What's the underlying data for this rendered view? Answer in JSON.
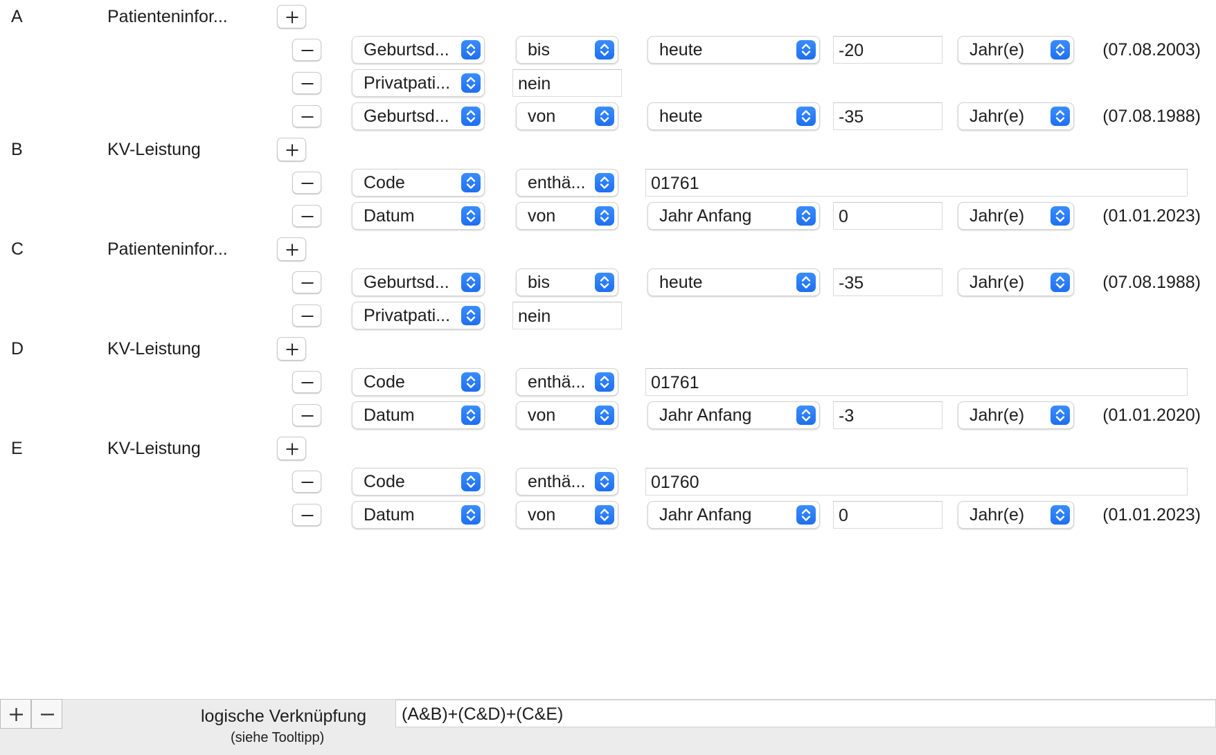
{
  "groups": [
    {
      "letter": "A",
      "name": "Patienteninfor...",
      "rows": [
        {
          "field": "Geburtsd...",
          "op": "bis",
          "base": "heute",
          "value": "-20",
          "unit": "Jahr(e)",
          "result": "(07.08.2003)"
        },
        {
          "field": "Privatpati...",
          "value": "nein"
        },
        {
          "field": "Geburtsd...",
          "op": "von",
          "base": "heute",
          "value": "-35",
          "unit": "Jahr(e)",
          "result": "(07.08.1988)"
        }
      ]
    },
    {
      "letter": "B",
      "name": "KV-Leistung",
      "rows": [
        {
          "field": "Code",
          "op": "enthä...",
          "value": "01761"
        },
        {
          "field": "Datum",
          "op": "von",
          "base": "Jahr Anfang",
          "value": "0",
          "unit": "Jahr(e)",
          "result": "(01.01.2023)"
        }
      ]
    },
    {
      "letter": "C",
      "name": "Patienteninfor...",
      "rows": [
        {
          "field": "Geburtsd...",
          "op": "bis",
          "base": "heute",
          "value": "-35",
          "unit": "Jahr(e)",
          "result": "(07.08.1988)"
        },
        {
          "field": "Privatpati...",
          "value": "nein"
        }
      ]
    },
    {
      "letter": "D",
      "name": "KV-Leistung",
      "rows": [
        {
          "field": "Code",
          "op": "enthä...",
          "value": "01761"
        },
        {
          "field": "Datum",
          "op": "von",
          "base": "Jahr Anfang",
          "value": "-3",
          "unit": "Jahr(e)",
          "result": "(01.01.2020)"
        }
      ]
    },
    {
      "letter": "E",
      "name": "KV-Leistung",
      "rows": [
        {
          "field": "Code",
          "op": "enthä...",
          "value": "01760"
        },
        {
          "field": "Datum",
          "op": "von",
          "base": "Jahr Anfang",
          "value": "0",
          "unit": "Jahr(e)",
          "result": "(01.01.2023)"
        }
      ]
    }
  ],
  "footer": {
    "logic_label": "logische Verknüpfung",
    "logic_hint": "(siehe Tooltipp)",
    "logic_value": "(A&B)+(C&D)+(C&E)"
  },
  "colors": {
    "accent": "#1f6ff0",
    "footer_bg": "#ececec"
  },
  "icons": {
    "add": "plus-icon",
    "remove": "minus-icon",
    "popup": "chevron-up-down-icon"
  }
}
